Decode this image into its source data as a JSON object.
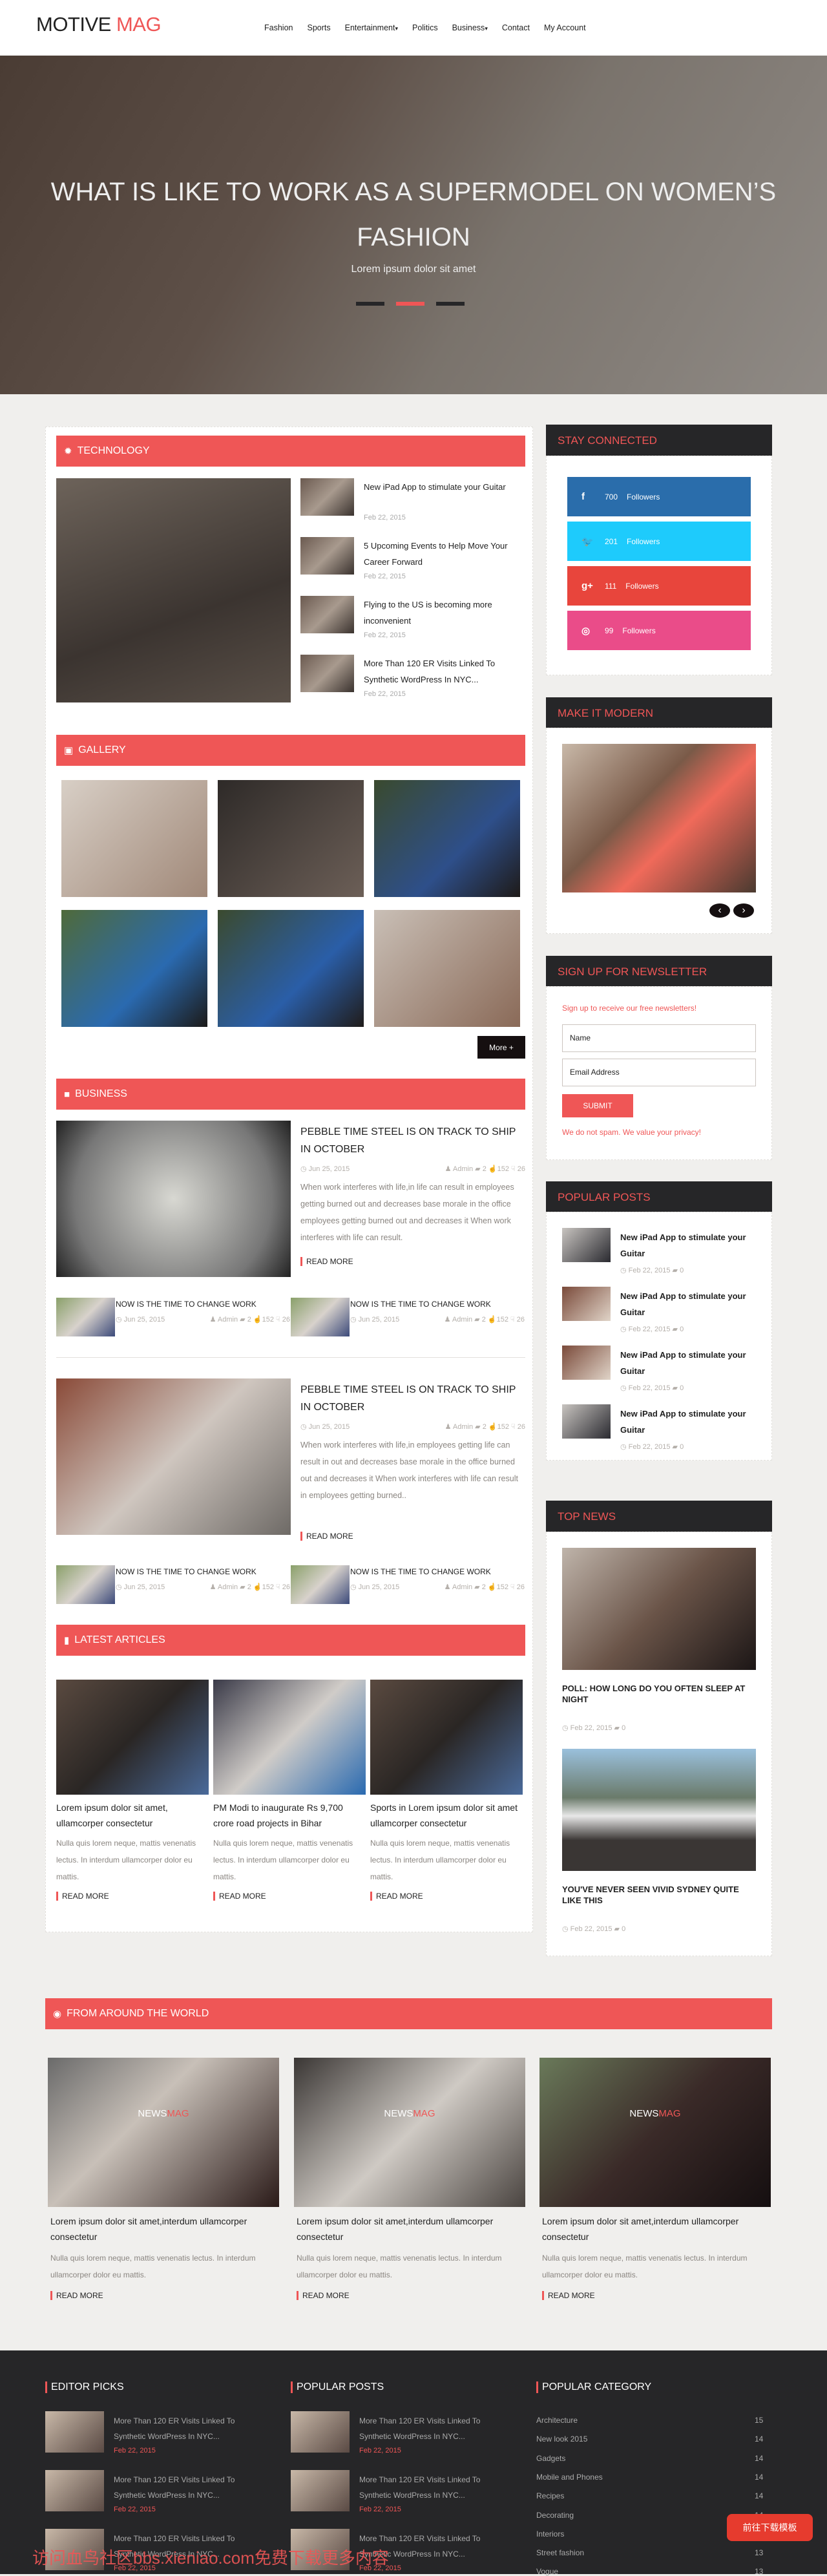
{
  "header": {
    "logo_a": "MOTIVE",
    "logo_b": "MAG",
    "nav": [
      {
        "label": "Fashion",
        "caret": ""
      },
      {
        "label": "Sports",
        "caret": ""
      },
      {
        "label": "Entertainment",
        "caret": "▾"
      },
      {
        "label": "Politics",
        "caret": ""
      },
      {
        "label": "Business",
        "caret": "▾"
      },
      {
        "label": "Contact",
        "caret": ""
      },
      {
        "label": "My Account",
        "caret": ""
      }
    ]
  },
  "hero": {
    "title": "WHAT IS LIKE TO WORK AS A SUPERMODEL ON WOMEN’S FASHION",
    "subtitle": "Lorem ipsum dolor sit amet",
    "slide_count": 3,
    "active_slide": 2
  },
  "technology": {
    "title": "TECHNOLOGY",
    "icon": "gear-icon",
    "items": [
      {
        "title": "New iPad App to stimulate your Guitar",
        "date": "Feb 22, 2015"
      },
      {
        "title": "5 Upcoming Events to Help Move Your Career Forward",
        "date": "Feb 22, 2015"
      },
      {
        "title": "Flying to the US is becoming more inconvenient",
        "date": "Feb 22, 2015"
      },
      {
        "title": "More Than 120 ER Visits Linked To Synthetic WordPress In NYC...",
        "date": "Feb 22, 2015"
      }
    ]
  },
  "gallery": {
    "title": "GALLERY",
    "icon": "image-icon",
    "more": "More +"
  },
  "business": {
    "title": "BUSINESS",
    "icon": "briefcase-icon",
    "features": [
      {
        "title": "PEBBLE TIME STEEL IS ON TRACK TO SHIP IN OCTOBER",
        "date": "Jun 25, 2015",
        "author": "Admin",
        "comments": "2",
        "likes": "152",
        "dislikes": "26",
        "excerpt": "When work interferes with life,in life can result in employees getting burned out and decreases base morale in the office employees getting burned out and decreases it When work interferes with life can result.",
        "read_more": "READ MORE",
        "small": [
          {
            "title": "NOW IS THE TIME TO CHANGE WORK",
            "date": "Jun 25, 2015",
            "author": "Admin",
            "comments": "2",
            "likes": "152",
            "dislikes": "26"
          },
          {
            "title": "NOW IS THE TIME TO CHANGE WORK",
            "date": "Jun 25, 2015",
            "author": "Admin",
            "comments": "2",
            "likes": "152",
            "dislikes": "26"
          }
        ]
      },
      {
        "title": "PEBBLE TIME STEEL IS ON TRACK TO SHIP IN OCTOBER",
        "date": "Jun 25, 2015",
        "author": "Admin",
        "comments": "2",
        "likes": "152",
        "dislikes": "26",
        "excerpt": "When work interferes with life,in employees getting life can result in out and decreases base morale in the office burned out and decreases it When work interferes with life can result in employees getting burned..",
        "read_more": "READ MORE",
        "small": [
          {
            "title": "NOW IS THE TIME TO CHANGE WORK",
            "date": "Jun 25, 2015",
            "author": "Admin",
            "comments": "2",
            "likes": "152",
            "dislikes": "26"
          },
          {
            "title": "NOW IS THE TIME TO CHANGE WORK",
            "date": "Jun 25, 2015",
            "author": "Admin",
            "comments": "2",
            "likes": "152",
            "dislikes": "26"
          }
        ]
      }
    ]
  },
  "latest": {
    "title": "LATEST ARTICLES",
    "icon": "file-icon",
    "items": [
      {
        "title": "Lorem ipsum dolor sit amet, ullamcorper consectetur",
        "excerpt": "Nulla quis lorem neque, mattis venenatis lectus. In interdum ullamcorper dolor eu mattis.",
        "read_more": "READ MORE"
      },
      {
        "title": "PM Modi to inaugurate Rs 9,700 crore road projects in Bihar",
        "excerpt": "Nulla quis lorem neque, mattis venenatis lectus. In interdum ullamcorper dolor eu mattis.",
        "read_more": "READ MORE"
      },
      {
        "title": "Sports in Lorem ipsum dolor sit amet ullamcorper consectetur",
        "excerpt": "Nulla quis lorem neque, mattis venenatis lectus. In interdum ullamcorper dolor eu mattis.",
        "read_more": "READ MORE"
      }
    ]
  },
  "sidebar": {
    "stay": {
      "title": "STAY CONNECTED",
      "items": [
        {
          "network": "facebook-icon",
          "glyph": "f",
          "count": "700",
          "label": "Followers",
          "color": "#2a6dab"
        },
        {
          "network": "twitter-icon",
          "glyph": "🐦",
          "count": "201",
          "label": "Followers",
          "color": "#1ecbfc"
        },
        {
          "network": "google-plus-icon",
          "glyph": "g+",
          "count": "111",
          "label": "Followers",
          "color": "#e8453c"
        },
        {
          "network": "dribbble-icon",
          "glyph": "◎",
          "count": "99",
          "label": "Followers",
          "color": "#ea4c89"
        }
      ]
    },
    "modern": {
      "title": "MAKE IT MODERN",
      "prev": "‹",
      "next": "›"
    },
    "newsletter": {
      "title": "SIGN UP FOR NEWSLETTER",
      "intro": "Sign up to receive our free newsletters!",
      "name_placeholder": "Name",
      "email_placeholder": "Email Address",
      "submit": "SUBMIT",
      "note": "We do not spam. We value your privacy!"
    },
    "popular": {
      "title": "POPULAR POSTS",
      "items": [
        {
          "title": "New iPad App to stimulate your Guitar",
          "date": "Feb 22, 2015",
          "comments": "0"
        },
        {
          "title": "New iPad App to stimulate your Guitar",
          "date": "Feb 22, 2015",
          "comments": "0"
        },
        {
          "title": "New iPad App to stimulate your Guitar",
          "date": "Feb 22, 2015",
          "comments": "0"
        },
        {
          "title": "New iPad App to stimulate your Guitar",
          "date": "Feb 22, 2015",
          "comments": "0"
        }
      ]
    },
    "top_news": {
      "title": "TOP NEWS",
      "items": [
        {
          "title": "POLL: HOW LONG DO YOU OFTEN SLEEP AT NIGHT",
          "date": "Feb 22, 2015",
          "comments": "0"
        },
        {
          "title": "YOU'VE NEVER SEEN VIVID SYDNEY QUITE LIKE THIS",
          "date": "Feb 22, 2015",
          "comments": "0"
        }
      ]
    }
  },
  "world": {
    "title": "FROM AROUND THE WORLD",
    "icon": "globe-icon",
    "items": [
      {
        "brand_a": "NEWS",
        "brand_b": "MAG",
        "title": "Lorem ipsum dolor sit amet,interdum ullamcorper consectetur",
        "excerpt": "Nulla quis lorem neque, mattis venenatis lectus. In interdum ullamcorper dolor eu mattis.",
        "read_more": "READ MORE"
      },
      {
        "brand_a": "NEWS",
        "brand_b": "MAG",
        "title": "Lorem ipsum dolor sit amet,interdum ullamcorper consectetur",
        "excerpt": "Nulla quis lorem neque, mattis venenatis lectus. In interdum ullamcorper dolor eu mattis.",
        "read_more": "READ MORE"
      },
      {
        "brand_a": "NEWS",
        "brand_b": "MAG",
        "title": "Lorem ipsum dolor sit amet,interdum ullamcorper consectetur",
        "excerpt": "Nulla quis lorem neque, mattis venenatis lectus. In interdum ullamcorper dolor eu mattis.",
        "read_more": "READ MORE"
      }
    ]
  },
  "footer": {
    "editor": {
      "title": "EDITOR PICKS",
      "items": [
        {
          "title": "More Than 120 ER Visits Linked To Synthetic WordPress In NYC...",
          "date": "Feb 22, 2015"
        },
        {
          "title": "More Than 120 ER Visits Linked To Synthetic WordPress In NYC...",
          "date": "Feb 22, 2015"
        },
        {
          "title": "More Than 120 ER Visits Linked To Synthetic WordPress In NYC...",
          "date": "Feb 22, 2015"
        }
      ]
    },
    "popular": {
      "title": "POPULAR POSTS",
      "items": [
        {
          "title": "More Than 120 ER Visits Linked To Synthetic WordPress In NYC...",
          "date": "Feb 22, 2015"
        },
        {
          "title": "More Than 120 ER Visits Linked To Synthetic WordPress In NYC...",
          "date": "Feb 22, 2015"
        },
        {
          "title": "More Than 120 ER Visits Linked To Synthetic WordPress In NYC...",
          "date": "Feb 22, 2015"
        }
      ]
    },
    "category": {
      "title": "POPULAR CATEGORY",
      "items": [
        {
          "name": "Architecture",
          "count": "15"
        },
        {
          "name": "New look 2015",
          "count": "14"
        },
        {
          "name": "Gadgets",
          "count": "14"
        },
        {
          "name": "Mobile and Phones",
          "count": "14"
        },
        {
          "name": "Recipes",
          "count": "14"
        },
        {
          "name": "Decorating",
          "count": "14"
        },
        {
          "name": "Interiors",
          "count": ""
        },
        {
          "name": "Street fashion",
          "count": "13"
        },
        {
          "name": "Vogue",
          "count": "13"
        }
      ]
    }
  },
  "overlay": {
    "download_button": "前往下载模板",
    "watermark": "访问血鸟社区bbs.xieniao.com免费下载更多内容"
  },
  "colors": {
    "accent": "#ef5656",
    "dark": "#262628",
    "background": "#f0efed"
  }
}
